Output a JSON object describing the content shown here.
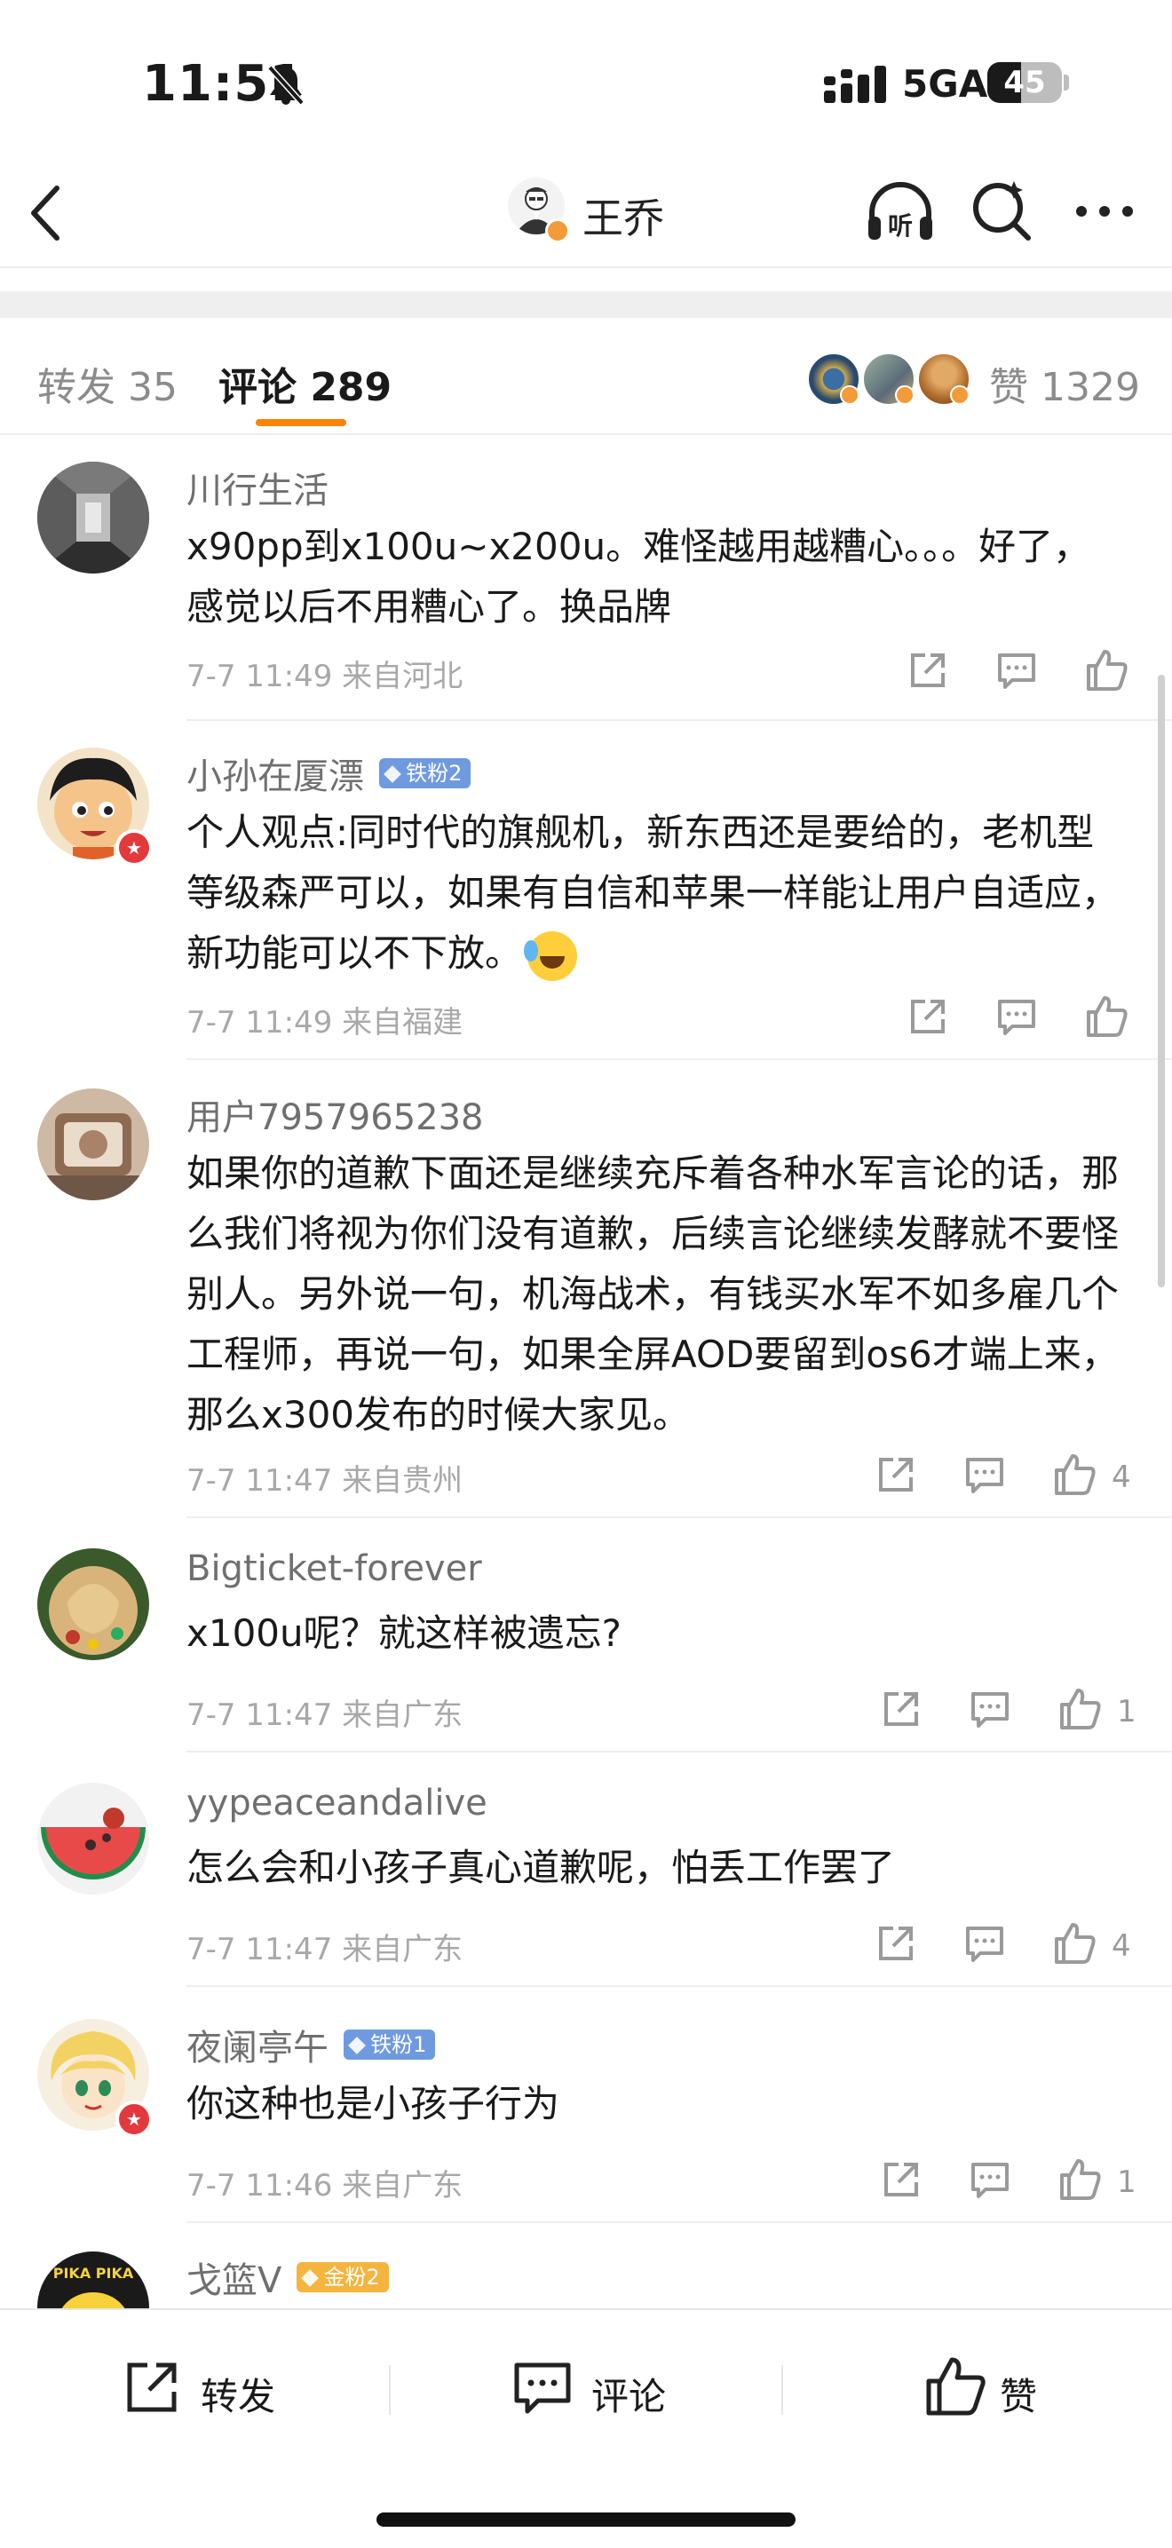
{
  "status_bar": {
    "time": "11:51",
    "network": "5GA",
    "battery": "45",
    "battery_level": 0.45
  },
  "nav": {
    "title": "王乔",
    "listen_label": "听"
  },
  "tabs": {
    "repost": "转发 35",
    "comments": "评论 289",
    "likes": "赞 1329"
  },
  "comments": [
    {
      "user": "川行生活",
      "fan_badge": "",
      "text": "x90pp到x100u~x200u。难怪越用越糟心。。。好了，感觉以后不用糟心了。换品牌",
      "meta": "7-7 11:49  来自河北",
      "likes": ""
    },
    {
      "user": "小孙在厦漂",
      "fan_badge": "铁粉2",
      "text": "个人观点:同时代的旗舰机，新东西还是要给的，老机型等级森严可以，如果有自信和苹果一样能让用户自适应，新功能可以不下放。",
      "meta": "7-7 11:49  来自福建",
      "likes": ""
    },
    {
      "user": "用户7957965238",
      "fan_badge": "",
      "text": "如果你的道歉下面还是继续充斥着各种水军言论的话，那么我们将视为你们没有道歉，后续言论继续发酵就不要怪别人。另外说一句，机海战术，有钱买水军不如多雇几个工程师，再说一句，如果全屏AOD要留到os6才端上来，那么x300发布的时候大家见。",
      "meta": "7-7 11:47  来自贵州",
      "likes": "4"
    },
    {
      "user": "Bigticket-forever",
      "fan_badge": "",
      "text": "x100u呢？就这样被遗忘?",
      "meta": "7-7 11:47  来自广东",
      "likes": "1"
    },
    {
      "user": "yypeaceandalive",
      "fan_badge": "",
      "text": "怎么会和小孩子真心道歉呢，怕丢工作罢了",
      "meta": "7-7 11:47  来自广东",
      "likes": "4"
    },
    {
      "user": "夜阑亭午",
      "fan_badge": "铁粉1",
      "text": "你这种也是小孩子行为",
      "meta": "7-7 11:46  来自广东",
      "likes": "1"
    },
    {
      "user": "戈篮V",
      "fan_badge": "金粉2",
      "text": "",
      "meta": "",
      "likes": ""
    }
  ],
  "bottom_bar": {
    "repost": "转发",
    "comment": "评论",
    "like": "赞"
  },
  "colors": {
    "accent": "#ff8200",
    "iron_fan": "#6f9ae0",
    "gold_fan": "#f4b43e",
    "verified": "#f29b38"
  }
}
